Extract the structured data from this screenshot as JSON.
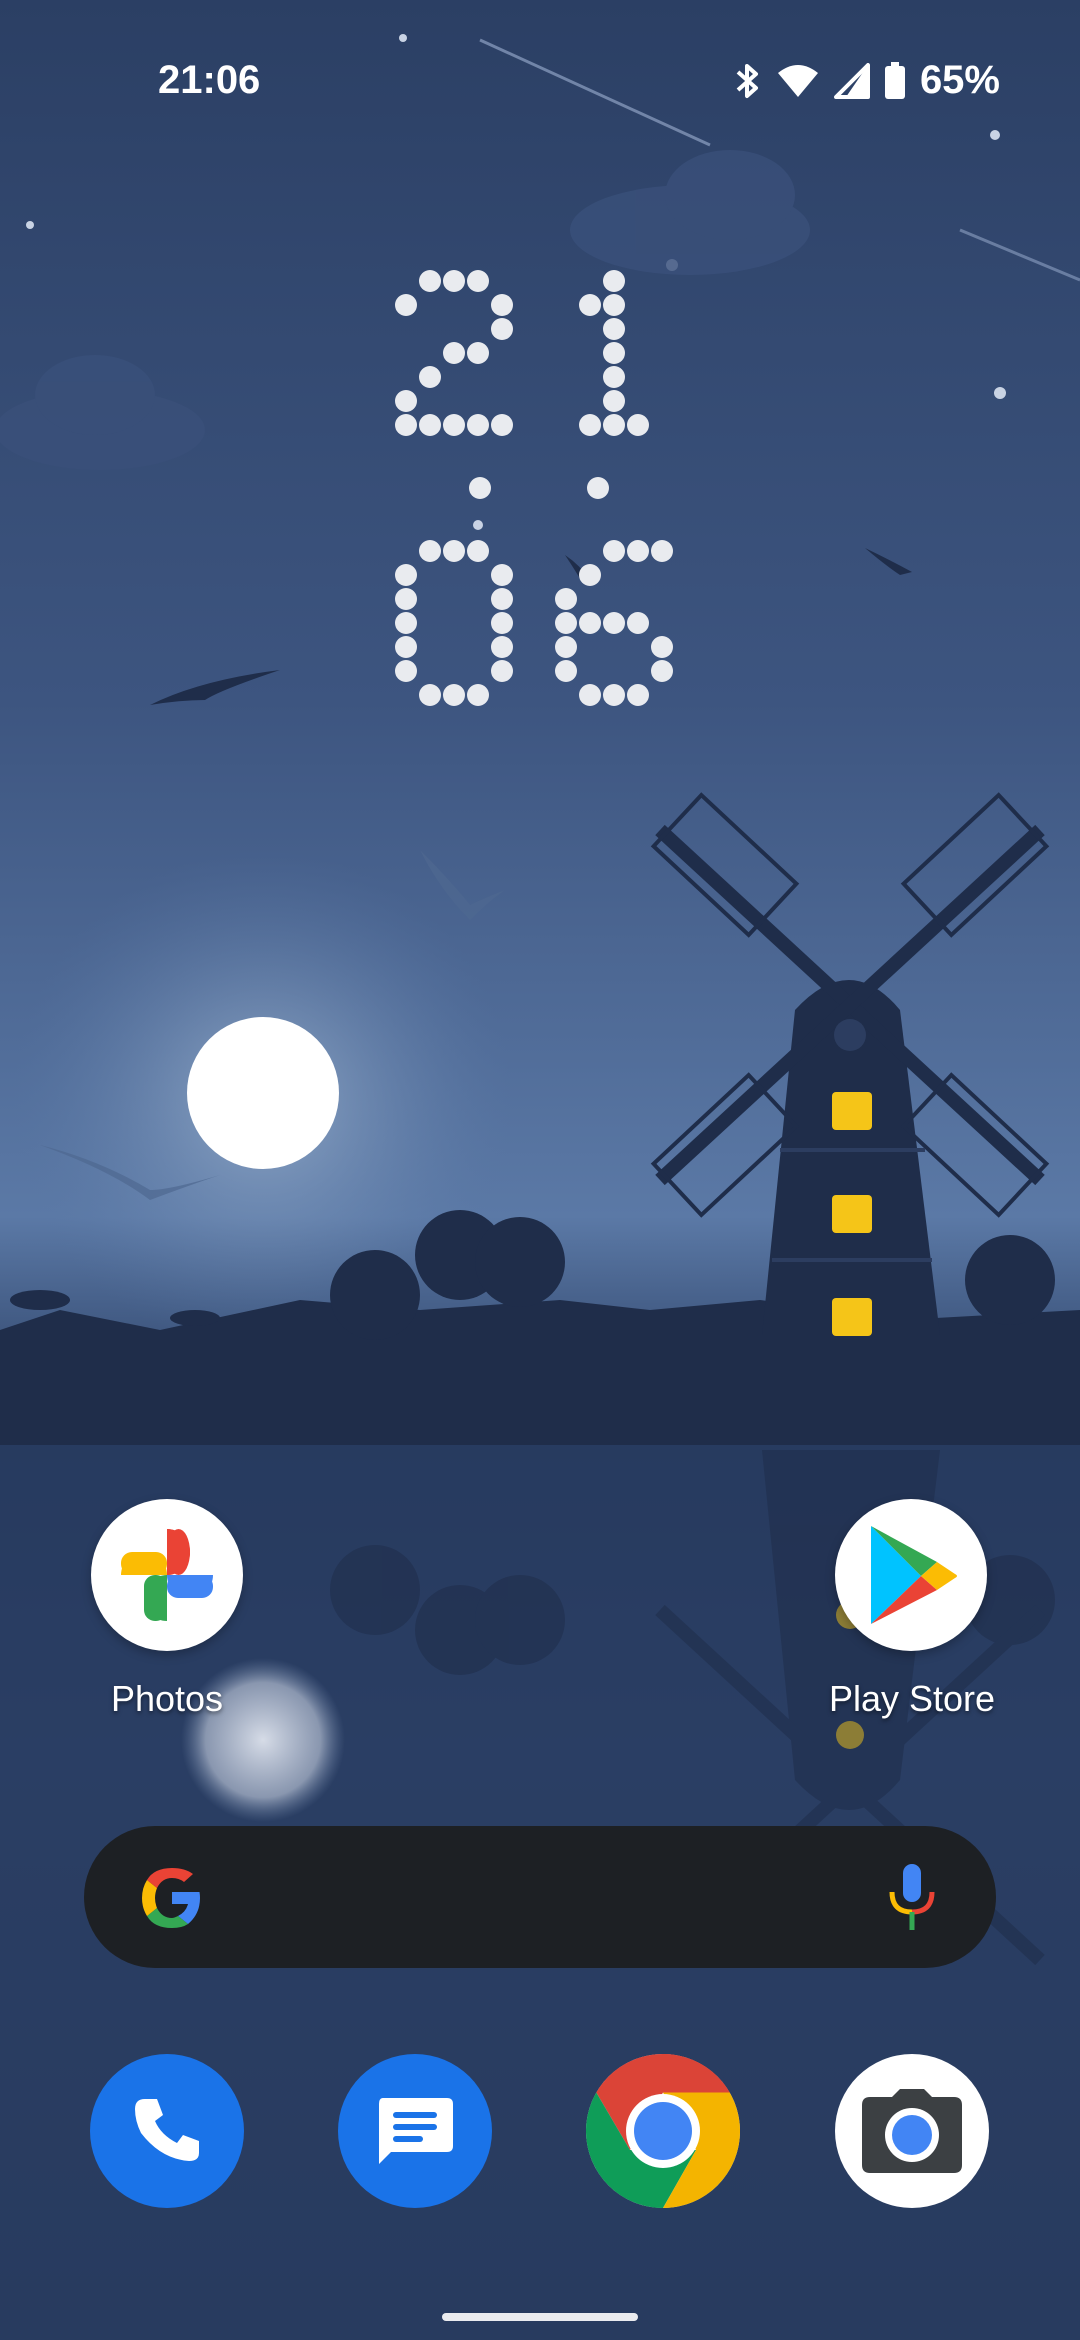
{
  "status_bar": {
    "time": "21:06",
    "battery_percent": "65%",
    "icons": [
      "bluetooth-icon",
      "wifi-icon",
      "cellular-signal-icon",
      "battery-icon"
    ]
  },
  "clock_widget": {
    "hours": "21",
    "minutes": "06",
    "dot_color": "#e9ebef"
  },
  "home_apps": [
    {
      "label": "Photos",
      "icon": "google-photos-icon"
    },
    {
      "label": "Play Store",
      "icon": "play-store-icon"
    }
  ],
  "search_widget": {
    "left_icon": "google-g-icon",
    "right_icon": "microphone-icon",
    "background": "#1d2024"
  },
  "dock": [
    {
      "icon": "phone-icon",
      "color": "#1a73e8"
    },
    {
      "icon": "messages-icon",
      "color": "#1a73e8"
    },
    {
      "icon": "chrome-icon",
      "color": "#ffffff"
    },
    {
      "icon": "camera-icon",
      "color": "#ffffff"
    }
  ],
  "colors": {
    "window_light": "#f5c518",
    "moon": "#ffffff",
    "landscape": "#1f2d4a"
  }
}
